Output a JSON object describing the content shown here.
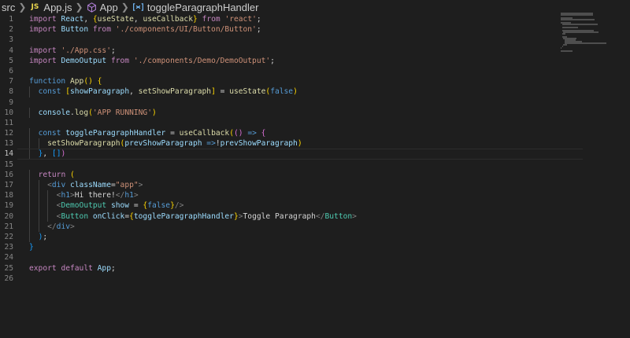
{
  "breadcrumb": {
    "items": [
      {
        "label": "src",
        "icon": null
      },
      {
        "label": "App.js",
        "icon": "js-file-icon"
      },
      {
        "label": "App",
        "icon": "cube-icon"
      },
      {
        "label": "toggleParagraphHandler",
        "icon": "variable-icon"
      }
    ]
  },
  "editor": {
    "active_line": 14,
    "lines": [
      {
        "n": "1",
        "text": "import React, {useState, useCallback} from 'react';"
      },
      {
        "n": "2",
        "text": "import Button from './components/UI/Button/Button';"
      },
      {
        "n": "3",
        "text": ""
      },
      {
        "n": "4",
        "text": "import './App.css';"
      },
      {
        "n": "5",
        "text": "import DemoOutput from './components/Demo/DemoOutput';"
      },
      {
        "n": "6",
        "text": ""
      },
      {
        "n": "7",
        "text": "function App() {"
      },
      {
        "n": "8",
        "text": "  const [showParagraph, setShowParagraph] = useState(false)"
      },
      {
        "n": "9",
        "text": ""
      },
      {
        "n": "10",
        "text": "  console.log('APP RUNNING')"
      },
      {
        "n": "11",
        "text": ""
      },
      {
        "n": "12",
        "text": "  const toggleParagraphHandler = useCallback(() => {"
      },
      {
        "n": "13",
        "text": "    setShowParagraph(prevShowParagraph =>!prevShowParagraph)"
      },
      {
        "n": "14",
        "text": "  }, [])"
      },
      {
        "n": "15",
        "text": ""
      },
      {
        "n": "16",
        "text": "  return ("
      },
      {
        "n": "17",
        "text": "    <div className=\"app\">"
      },
      {
        "n": "18",
        "text": "      <h1>Hi there!</h1>"
      },
      {
        "n": "19",
        "text": "      <DemoOutput show = {false}/>"
      },
      {
        "n": "20",
        "text": "      <Button onClick={toggleParagraphHandler}>Toggle Paragraph</Button>"
      },
      {
        "n": "21",
        "text": "    </div>"
      },
      {
        "n": "22",
        "text": "  );"
      },
      {
        "n": "23",
        "text": "}"
      },
      {
        "n": "24",
        "text": ""
      },
      {
        "n": "25",
        "text": "export default App;"
      },
      {
        "n": "26",
        "text": ""
      }
    ]
  },
  "colors": {
    "background": "#1e1e1e",
    "keyword": "#c586c0",
    "storage": "#569cd6",
    "function": "#dcdcaa",
    "variable": "#9cdcfe",
    "string": "#ce9178",
    "component": "#4ec9b0"
  }
}
